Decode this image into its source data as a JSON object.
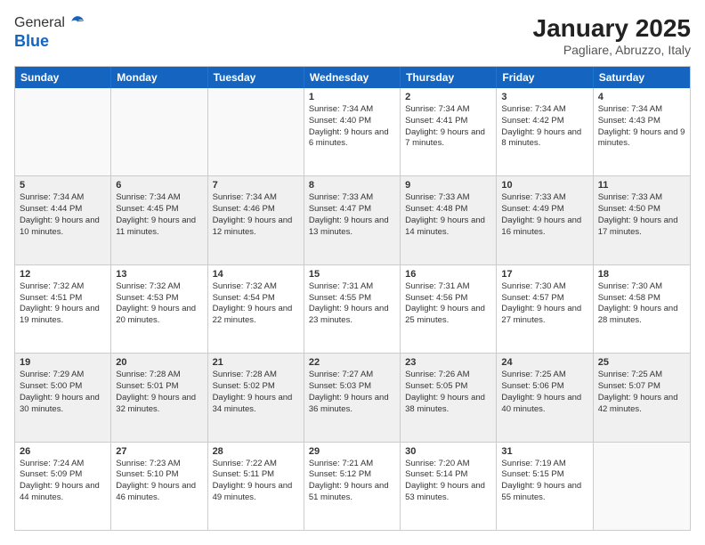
{
  "header": {
    "logo_general": "General",
    "logo_blue": "Blue",
    "title": "January 2025",
    "subtitle": "Pagliare, Abruzzo, Italy"
  },
  "days_of_week": [
    "Sunday",
    "Monday",
    "Tuesday",
    "Wednesday",
    "Thursday",
    "Friday",
    "Saturday"
  ],
  "weeks": [
    [
      {
        "day": "",
        "info": "",
        "empty": true
      },
      {
        "day": "",
        "info": "",
        "empty": true
      },
      {
        "day": "",
        "info": "",
        "empty": true
      },
      {
        "day": "1",
        "info": "Sunrise: 7:34 AM\nSunset: 4:40 PM\nDaylight: 9 hours and 6 minutes."
      },
      {
        "day": "2",
        "info": "Sunrise: 7:34 AM\nSunset: 4:41 PM\nDaylight: 9 hours and 7 minutes."
      },
      {
        "day": "3",
        "info": "Sunrise: 7:34 AM\nSunset: 4:42 PM\nDaylight: 9 hours and 8 minutes."
      },
      {
        "day": "4",
        "info": "Sunrise: 7:34 AM\nSunset: 4:43 PM\nDaylight: 9 hours and 9 minutes."
      }
    ],
    [
      {
        "day": "5",
        "info": "Sunrise: 7:34 AM\nSunset: 4:44 PM\nDaylight: 9 hours and 10 minutes.",
        "shaded": true
      },
      {
        "day": "6",
        "info": "Sunrise: 7:34 AM\nSunset: 4:45 PM\nDaylight: 9 hours and 11 minutes.",
        "shaded": true
      },
      {
        "day": "7",
        "info": "Sunrise: 7:34 AM\nSunset: 4:46 PM\nDaylight: 9 hours and 12 minutes.",
        "shaded": true
      },
      {
        "day": "8",
        "info": "Sunrise: 7:33 AM\nSunset: 4:47 PM\nDaylight: 9 hours and 13 minutes.",
        "shaded": true
      },
      {
        "day": "9",
        "info": "Sunrise: 7:33 AM\nSunset: 4:48 PM\nDaylight: 9 hours and 14 minutes.",
        "shaded": true
      },
      {
        "day": "10",
        "info": "Sunrise: 7:33 AM\nSunset: 4:49 PM\nDaylight: 9 hours and 16 minutes.",
        "shaded": true
      },
      {
        "day": "11",
        "info": "Sunrise: 7:33 AM\nSunset: 4:50 PM\nDaylight: 9 hours and 17 minutes.",
        "shaded": true
      }
    ],
    [
      {
        "day": "12",
        "info": "Sunrise: 7:32 AM\nSunset: 4:51 PM\nDaylight: 9 hours and 19 minutes."
      },
      {
        "day": "13",
        "info": "Sunrise: 7:32 AM\nSunset: 4:53 PM\nDaylight: 9 hours and 20 minutes."
      },
      {
        "day": "14",
        "info": "Sunrise: 7:32 AM\nSunset: 4:54 PM\nDaylight: 9 hours and 22 minutes."
      },
      {
        "day": "15",
        "info": "Sunrise: 7:31 AM\nSunset: 4:55 PM\nDaylight: 9 hours and 23 minutes."
      },
      {
        "day": "16",
        "info": "Sunrise: 7:31 AM\nSunset: 4:56 PM\nDaylight: 9 hours and 25 minutes."
      },
      {
        "day": "17",
        "info": "Sunrise: 7:30 AM\nSunset: 4:57 PM\nDaylight: 9 hours and 27 minutes."
      },
      {
        "day": "18",
        "info": "Sunrise: 7:30 AM\nSunset: 4:58 PM\nDaylight: 9 hours and 28 minutes."
      }
    ],
    [
      {
        "day": "19",
        "info": "Sunrise: 7:29 AM\nSunset: 5:00 PM\nDaylight: 9 hours and 30 minutes.",
        "shaded": true
      },
      {
        "day": "20",
        "info": "Sunrise: 7:28 AM\nSunset: 5:01 PM\nDaylight: 9 hours and 32 minutes.",
        "shaded": true
      },
      {
        "day": "21",
        "info": "Sunrise: 7:28 AM\nSunset: 5:02 PM\nDaylight: 9 hours and 34 minutes.",
        "shaded": true
      },
      {
        "day": "22",
        "info": "Sunrise: 7:27 AM\nSunset: 5:03 PM\nDaylight: 9 hours and 36 minutes.",
        "shaded": true
      },
      {
        "day": "23",
        "info": "Sunrise: 7:26 AM\nSunset: 5:05 PM\nDaylight: 9 hours and 38 minutes.",
        "shaded": true
      },
      {
        "day": "24",
        "info": "Sunrise: 7:25 AM\nSunset: 5:06 PM\nDaylight: 9 hours and 40 minutes.",
        "shaded": true
      },
      {
        "day": "25",
        "info": "Sunrise: 7:25 AM\nSunset: 5:07 PM\nDaylight: 9 hours and 42 minutes.",
        "shaded": true
      }
    ],
    [
      {
        "day": "26",
        "info": "Sunrise: 7:24 AM\nSunset: 5:09 PM\nDaylight: 9 hours and 44 minutes."
      },
      {
        "day": "27",
        "info": "Sunrise: 7:23 AM\nSunset: 5:10 PM\nDaylight: 9 hours and 46 minutes."
      },
      {
        "day": "28",
        "info": "Sunrise: 7:22 AM\nSunset: 5:11 PM\nDaylight: 9 hours and 49 minutes."
      },
      {
        "day": "29",
        "info": "Sunrise: 7:21 AM\nSunset: 5:12 PM\nDaylight: 9 hours and 51 minutes."
      },
      {
        "day": "30",
        "info": "Sunrise: 7:20 AM\nSunset: 5:14 PM\nDaylight: 9 hours and 53 minutes."
      },
      {
        "day": "31",
        "info": "Sunrise: 7:19 AM\nSunset: 5:15 PM\nDaylight: 9 hours and 55 minutes."
      },
      {
        "day": "",
        "info": "",
        "empty": true
      }
    ]
  ]
}
